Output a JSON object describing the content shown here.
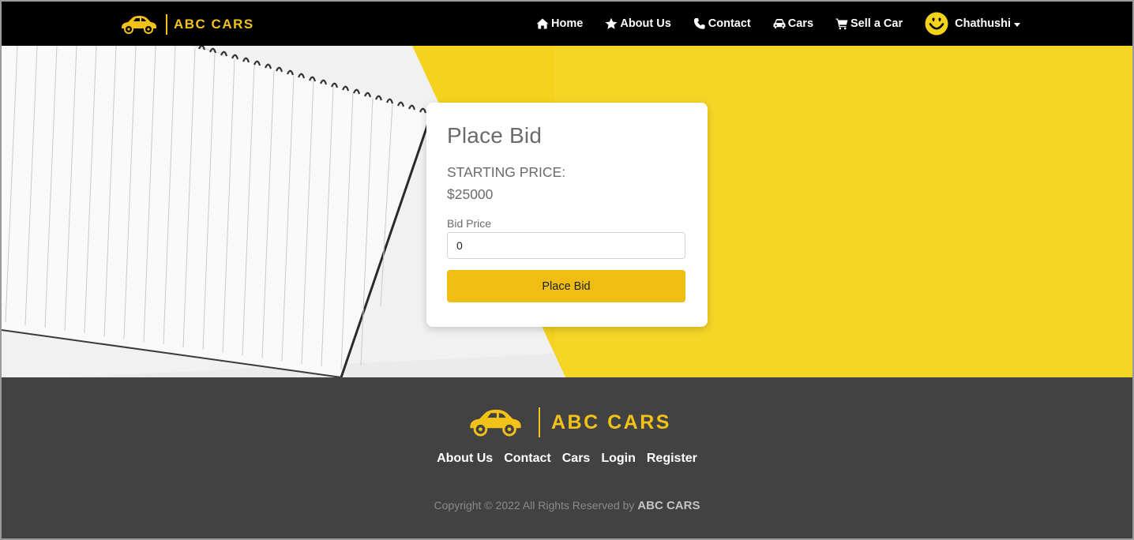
{
  "colors": {
    "accent": "#f3c218",
    "navbar_bg": "#000000",
    "footer_bg": "#424242",
    "hero_bg": "#f4d21e"
  },
  "navbar": {
    "brand": {
      "logo_icon": "car-icon",
      "name": "ABC CARS"
    },
    "items": [
      {
        "label": "Home",
        "icon": "home-icon"
      },
      {
        "label": "About Us",
        "icon": "star-icon"
      },
      {
        "label": "Contact",
        "icon": "phone-icon"
      },
      {
        "label": "Cars",
        "icon": "car-front-icon"
      },
      {
        "label": "Sell a Car",
        "icon": "cart-icon"
      }
    ],
    "user": {
      "avatar_icon": "smiley-icon",
      "name": "Chathushi"
    }
  },
  "bid_form": {
    "title": "Place Bid",
    "starting_price_label": "STARTING PRICE:",
    "starting_price_value": "$25000",
    "bid_price_label": "Bid Price",
    "bid_price_value": "0",
    "submit_label": "Place Bid"
  },
  "footer": {
    "brand_name": "ABC CARS",
    "links": [
      "About Us",
      "Contact",
      "Cars",
      "Login",
      "Register"
    ],
    "copyright_prefix": "Copyright © 2022 All Rights Reserved by",
    "copyright_brand": "ABC CARS"
  }
}
